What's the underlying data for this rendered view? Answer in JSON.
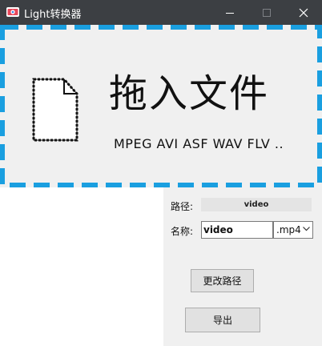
{
  "window": {
    "title": "Light转换器",
    "controls": {
      "minimize": "minimize-icon",
      "maximize": "maximize-icon",
      "close": "close-icon"
    }
  },
  "dropzone": {
    "title": "拖入文件",
    "formats": "MPEG  AVI  ASF  WAV  FLV ..",
    "icon": "file-icon",
    "border_color": "#1a9fe0"
  },
  "path": {
    "label": "路径:",
    "value": "video"
  },
  "name": {
    "label": "名称:",
    "value": "video"
  },
  "extension": {
    "selected": ".mp4"
  },
  "buttons": {
    "change_path": "更改路径",
    "export": "导出"
  }
}
